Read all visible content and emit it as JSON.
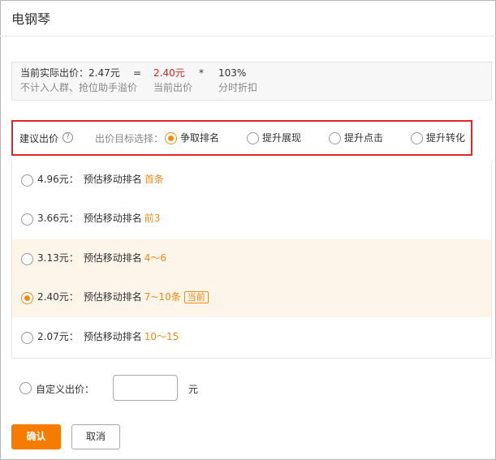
{
  "dialog": {
    "title": "电钢琴"
  },
  "price_summary": {
    "actual_label": "当前实际出价：2.47元",
    "equals": "=",
    "current_price": "2.40元",
    "multiply": "*",
    "discount": "103%",
    "actual_note": "不计入人群、抢位助手溢价",
    "current_note": "当前出价",
    "discount_note": "分时折扣"
  },
  "bid_header": {
    "label": "建议出价",
    "help_glyph": "?",
    "target_label": "出价目标选择：",
    "options": [
      {
        "label": "争取排名",
        "selected": true
      },
      {
        "label": "提升展现",
        "selected": false
      },
      {
        "label": "提升点击",
        "selected": false
      },
      {
        "label": "提升转化",
        "selected": false
      }
    ]
  },
  "rank_rows": [
    {
      "price": "4.96元：",
      "estimate": "预估移动排名",
      "position": "首条",
      "badge": "",
      "selected": false,
      "highlight": false
    },
    {
      "price": "3.66元：",
      "estimate": "预估移动排名",
      "position": "前3",
      "badge": "",
      "selected": false,
      "highlight": false
    },
    {
      "price": "3.13元：",
      "estimate": "预估移动排名",
      "position": "4～6",
      "badge": "",
      "selected": false,
      "highlight": true
    },
    {
      "price": "2.40元：",
      "estimate": "预估移动排名",
      "position": "7~10条",
      "badge": "当前",
      "selected": true,
      "highlight": true
    },
    {
      "price": "2.07元：",
      "estimate": "预估移动排名",
      "position": "10～15",
      "badge": "",
      "selected": false,
      "highlight": false
    }
  ],
  "custom_bid": {
    "label": "自定义出价：",
    "value": "",
    "unit": "元"
  },
  "buttons": {
    "confirm": "确认",
    "cancel": "取消"
  },
  "colors": {
    "accent": "#f08a16",
    "price_red": "#e02020",
    "highlight_frame": "#e02828",
    "confirm_bg": "#f57c00"
  }
}
